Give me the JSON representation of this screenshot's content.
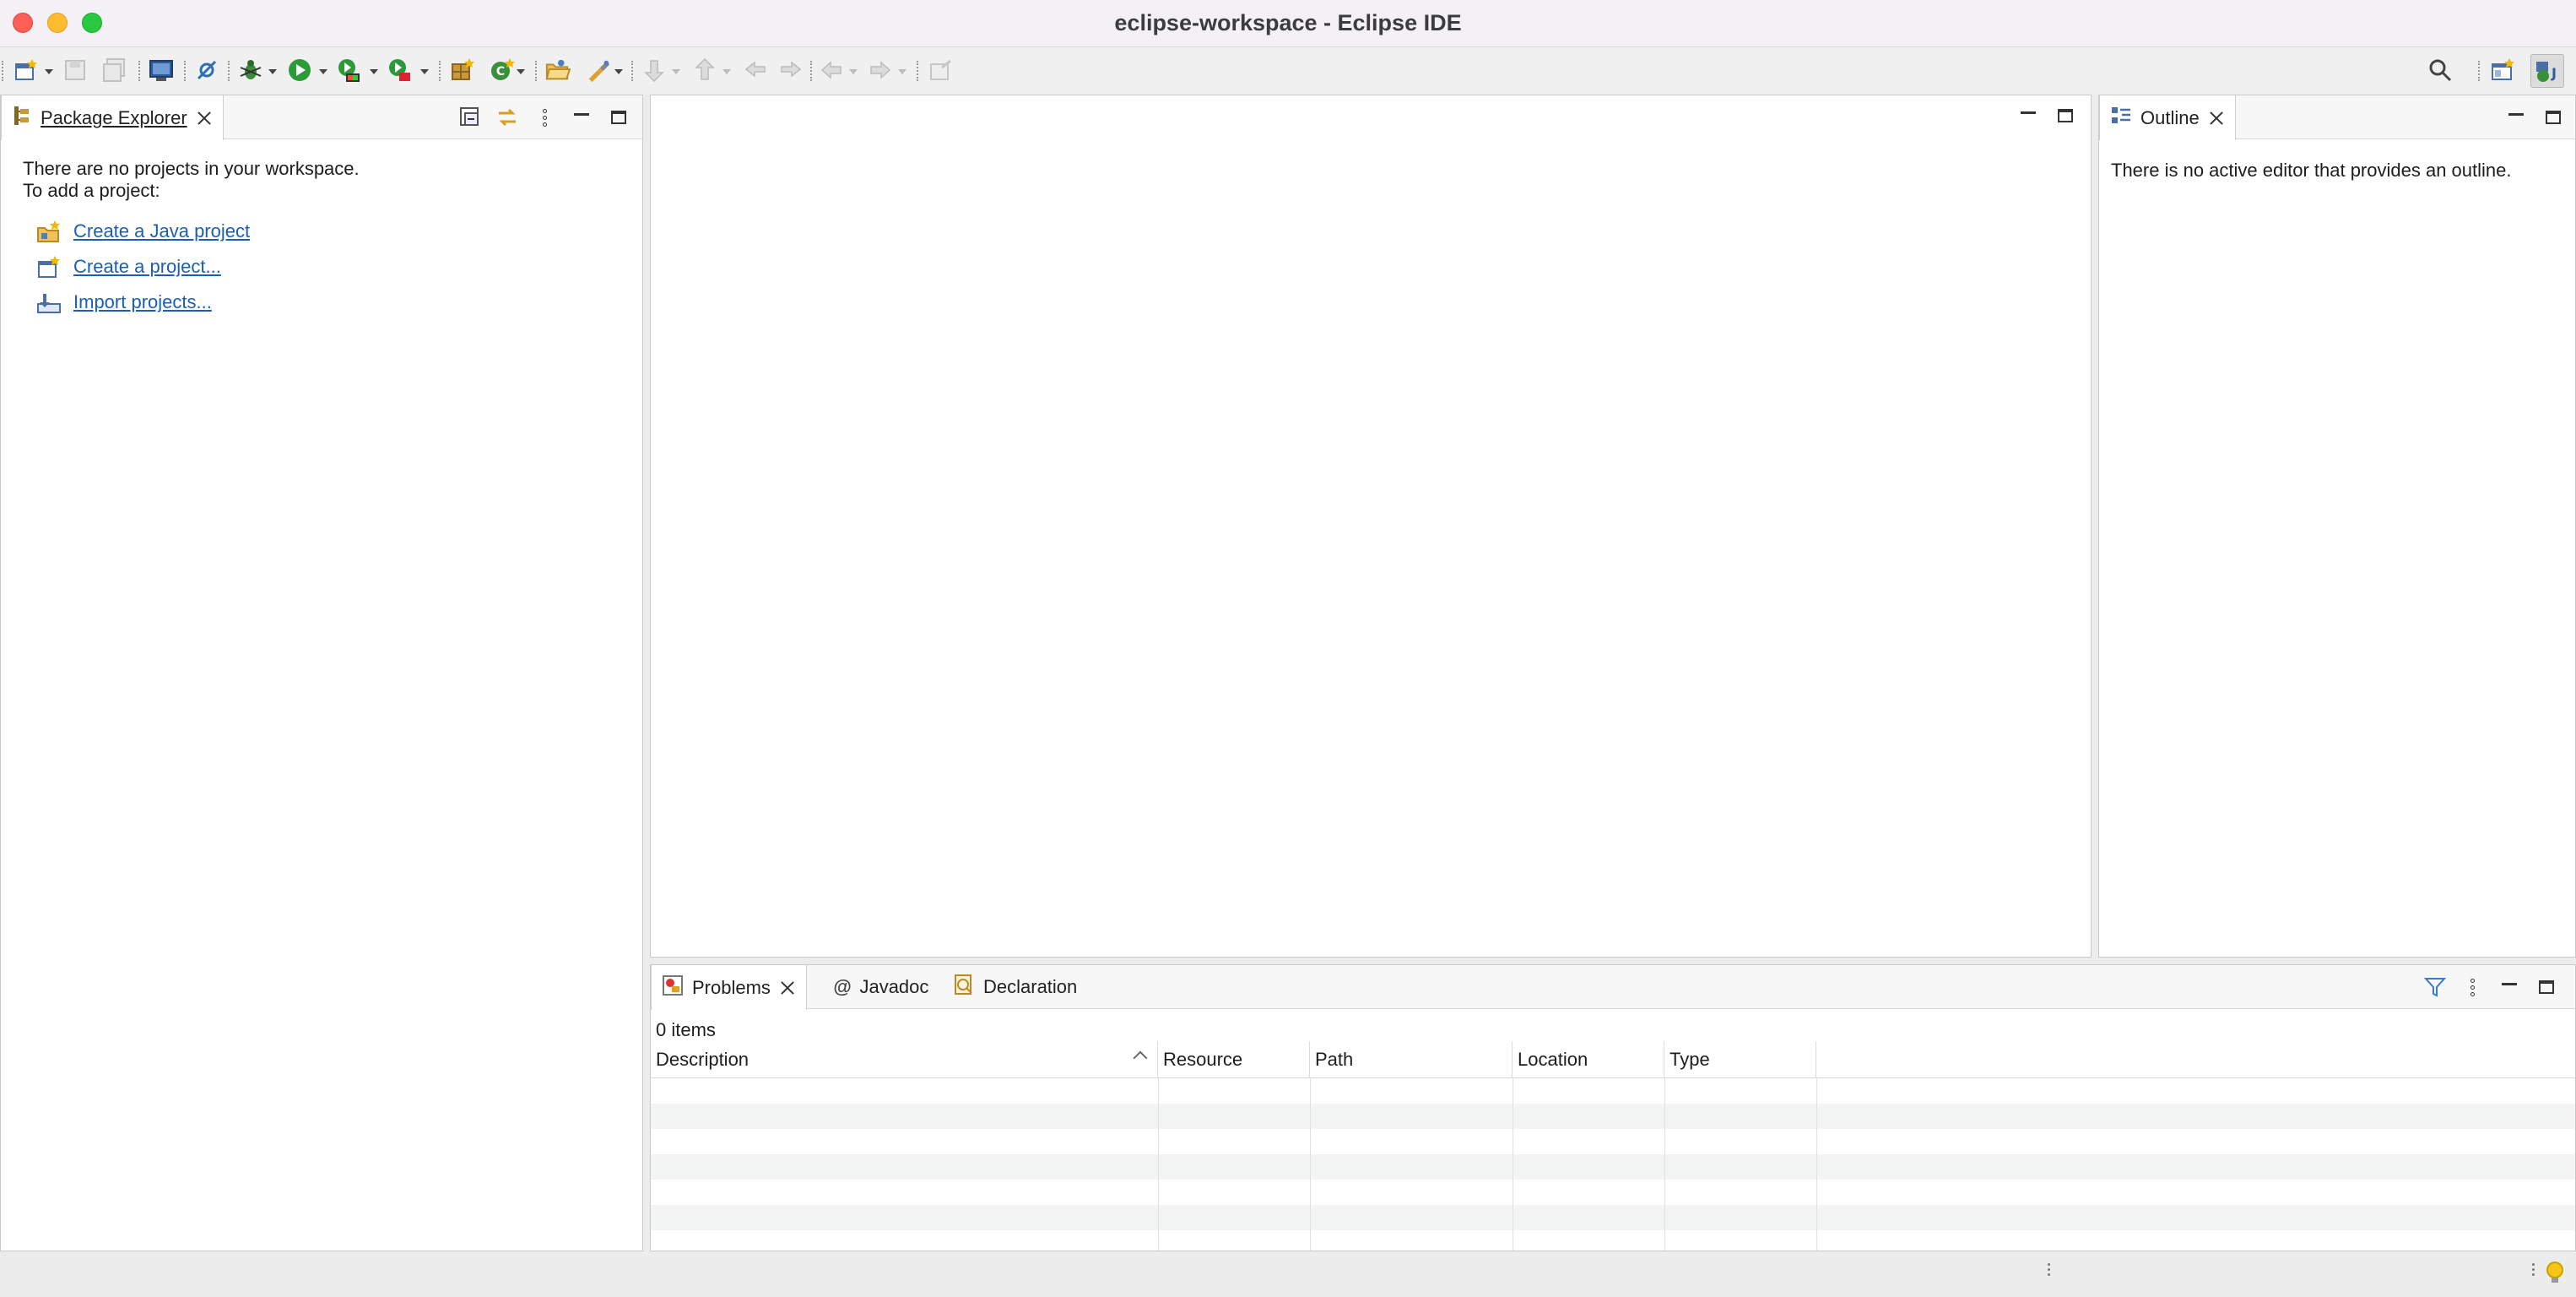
{
  "window": {
    "title": "eclipse-workspace - Eclipse IDE"
  },
  "toolbar": {
    "icons": [
      "new-icon",
      "save-icon",
      "save-all-icon",
      "terminal-icon",
      "skip-breakpoints-icon",
      "debug-icon",
      "run-icon",
      "coverage-icon",
      "run-external-icon",
      "new-java-package-icon",
      "new-java-class-icon",
      "open-type-icon",
      "search-tasks-icon",
      "next-annotation-icon",
      "prev-annotation-icon",
      "last-edit-icon",
      "back-icon",
      "forward-icon",
      "pin-editor-icon",
      "search-icon",
      "open-perspective-icon",
      "java-perspective-icon"
    ]
  },
  "package_explorer": {
    "tab_label": "Package Explorer",
    "message_line1": "There are no projects in your workspace.",
    "message_line2": "To add a project:",
    "links": [
      {
        "label": "Create a Java project",
        "icon": "new-java-project-icon"
      },
      {
        "label": "Create a project...",
        "icon": "new-project-icon"
      },
      {
        "label": "Import projects...",
        "icon": "import-icon"
      }
    ]
  },
  "outline": {
    "tab_label": "Outline",
    "message": "There is no active editor that provides an outline."
  },
  "bottom_panel": {
    "tabs": [
      {
        "label": "Problems",
        "icon": "problems-icon"
      },
      {
        "label": "Javadoc",
        "icon": "javadoc-icon"
      },
      {
        "label": "Declaration",
        "icon": "declaration-icon"
      }
    ],
    "items_count": "0 items",
    "columns": [
      "Description",
      "Resource",
      "Path",
      "Location",
      "Type"
    ]
  },
  "colors": {
    "link": "#1a5fb4",
    "titlebar": "#f4f1f6",
    "close": "#fe5f57",
    "minimize": "#febc2e",
    "maximize": "#28c840"
  }
}
